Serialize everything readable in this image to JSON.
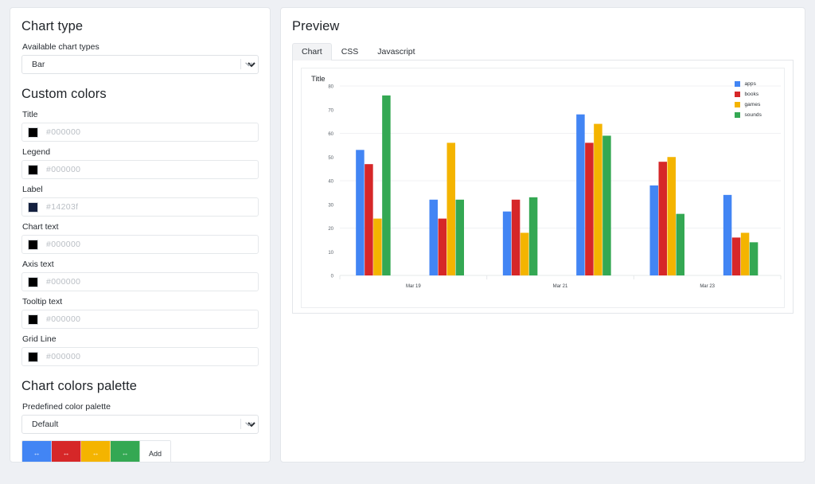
{
  "left_panel": {
    "chart_type_heading": "Chart type",
    "available_label": "Available chart types",
    "chart_type_value": "Bar",
    "chart_type_options": [
      "Bar"
    ],
    "custom_colors_heading": "Custom colors",
    "color_fields": [
      {
        "label": "Title",
        "value": "#000000",
        "swatch": "#000000"
      },
      {
        "label": "Legend",
        "value": "#000000",
        "swatch": "#000000"
      },
      {
        "label": "Label",
        "value": "#14203f",
        "swatch": "#14203f"
      },
      {
        "label": "Chart text",
        "value": "#000000",
        "swatch": "#000000"
      },
      {
        "label": "Axis text",
        "value": "#000000",
        "swatch": "#000000"
      },
      {
        "label": "Tooltip text",
        "value": "#000000",
        "swatch": "#000000"
      },
      {
        "label": "Grid Line",
        "value": "#000000",
        "swatch": "#000000"
      }
    ],
    "palette_heading": "Chart colors palette",
    "palette_label": "Predefined color palette",
    "palette_value": "Default",
    "palette_options": [
      "Default"
    ],
    "palette_swatches": [
      {
        "color": "#4285f4",
        "handle": "↔"
      },
      {
        "color": "#d62728",
        "handle": "↔"
      },
      {
        "color": "#f4b400",
        "handle": "↔"
      },
      {
        "color": "#34a853",
        "handle": "↔"
      }
    ],
    "add_button_label": "Add"
  },
  "right_panel": {
    "heading": "Preview",
    "tabs": [
      {
        "label": "Chart",
        "active": true
      },
      {
        "label": "CSS",
        "active": false
      },
      {
        "label": "Javascript",
        "active": false
      }
    ]
  },
  "chart_data": {
    "type": "bar",
    "title": "Title",
    "xlabel": "",
    "ylabel": "",
    "ylim": [
      0,
      80
    ],
    "yticks": [
      0,
      10,
      20,
      30,
      40,
      50,
      60,
      70,
      80
    ],
    "grid": true,
    "grid_color": "#f0f1f3",
    "legend_position": "top-right",
    "categories": [
      "Mar 19",
      "",
      "Mar 21",
      "",
      "Mar 23",
      ""
    ],
    "tick_labels": [
      "Mar 19",
      "Mar 21",
      "Mar 23"
    ],
    "series": [
      {
        "name": "apps",
        "color": "#4285f4",
        "values": [
          53,
          32,
          27,
          68,
          38,
          34
        ]
      },
      {
        "name": "books",
        "color": "#d62728",
        "values": [
          47,
          24,
          32,
          56,
          48,
          16
        ]
      },
      {
        "name": "games",
        "color": "#f4b400",
        "values": [
          24,
          56,
          18,
          64,
          50,
          18
        ]
      },
      {
        "name": "sounds",
        "color": "#34a853",
        "values": [
          76,
          32,
          33,
          59,
          26,
          14
        ]
      }
    ]
  }
}
